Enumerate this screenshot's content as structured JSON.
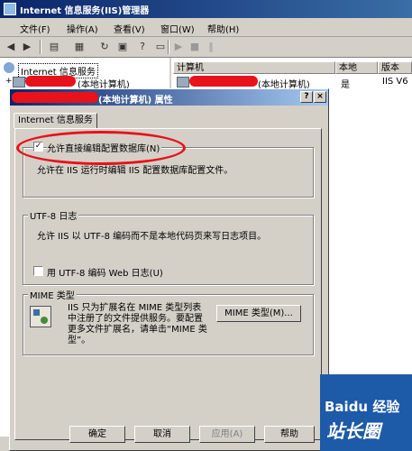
{
  "window": {
    "title": "Internet 信息服务(IIS)管理器"
  },
  "menu": [
    {
      "label": "文件(F)"
    },
    {
      "label": "操作(A)"
    },
    {
      "label": "查看(V)"
    },
    {
      "label": "窗口(W)"
    },
    {
      "label": "帮助(H)"
    }
  ],
  "toolbar": {
    "back_icon": "arrow-left-icon",
    "forward_icon": "arrow-right-icon",
    "play_icon": "play-icon",
    "stop_icon": "stop-icon",
    "pause_icon": "pause-icon"
  },
  "tree": {
    "root": "Internet 信息服务",
    "node_suffix": "(本地计算机)"
  },
  "list": {
    "columns": [
      "计算机",
      "本地",
      "版本"
    ],
    "row": {
      "computer_suffix": "(本地计算机)",
      "local": "是",
      "version": "IIS V6"
    }
  },
  "dialog": {
    "title": "(本地计算机) 属性",
    "help_btn": "?",
    "close_btn": "×",
    "tab": "Internet 信息服务",
    "direct_edit": {
      "checked": true,
      "label": "允许直接编辑配置数据库(N)",
      "description": "允许在 IIS 运行时编辑 IIS 配置数据库配置文件。"
    },
    "utf8": {
      "legend": "UTF-8 日志",
      "description": "允许 IIS 以 UTF-8 编码而不是本地代码页来写日志项目。",
      "checkbox_label": "用 UTF-8 编码 Web 日志(U)",
      "checked": false
    },
    "mime": {
      "legend": "MIME 类型",
      "lines": [
        "IIS 只为扩展名在 MIME 类型列表",
        "中注册了的文件提供服务。要配置",
        "更多文件扩展名，请单击“MIME 类",
        "型”。"
      ],
      "button": "MIME 类型(M)..."
    },
    "buttons": {
      "ok": "确定",
      "cancel": "取消",
      "apply": "应用(A)",
      "help": "帮助"
    }
  },
  "watermark": {
    "line1": "Baidu 经验",
    "line2": "站长圈"
  },
  "colors": {
    "title_blue": "#0a246a",
    "highlight_red": "#e8121a",
    "watermark_blue": "#1d5aa8"
  }
}
